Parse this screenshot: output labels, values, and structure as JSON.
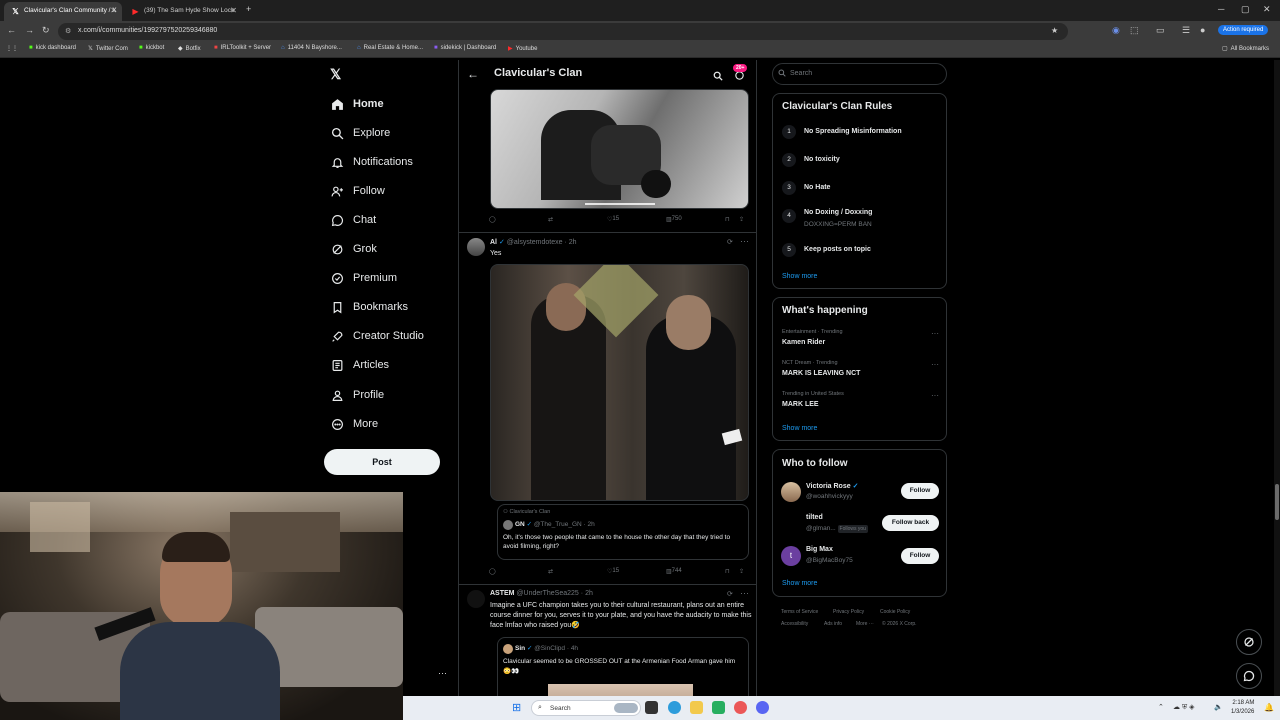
{
  "browser": {
    "tabs": [
      {
        "title": "Clavicular's Clan Community / X",
        "active": true
      },
      {
        "title": "(39) The Sam Hyde Show Lock",
        "active": false
      }
    ],
    "url": "x.com/i/communities/1992797520259346880",
    "action_required": "Action required",
    "bookmarks": [
      "kick dashboard",
      "Twitter Com",
      "kickbot",
      "Botfix",
      "IRLToolkit + Server",
      "11404 N Bayshore...",
      "Real Estate & Home...",
      "sidekick | Dashboard",
      "Youtube"
    ],
    "all_bookmarks": "All Bookmarks"
  },
  "nav": {
    "items": [
      {
        "label": "Home",
        "icon": "home-icon"
      },
      {
        "label": "Explore",
        "icon": "search-icon"
      },
      {
        "label": "Notifications",
        "icon": "bell-icon"
      },
      {
        "label": "Follow",
        "icon": "add-user-icon"
      },
      {
        "label": "Chat",
        "icon": "chat-icon"
      },
      {
        "label": "Grok",
        "icon": "grok-icon"
      },
      {
        "label": "Premium",
        "icon": "premium-icon"
      },
      {
        "label": "Bookmarks",
        "icon": "bookmark-icon"
      },
      {
        "label": "Creator Studio",
        "icon": "rocket-icon"
      },
      {
        "label": "Articles",
        "icon": "article-icon"
      },
      {
        "label": "Profile",
        "icon": "profile-icon"
      },
      {
        "label": "More",
        "icon": "more-icon"
      }
    ],
    "post_label": "Post"
  },
  "header": {
    "title": "Clavicular's Clan",
    "badge": "20+"
  },
  "feed": {
    "post1": {
      "replies": "",
      "reposts": "",
      "likes": "15",
      "views": "750"
    },
    "post2": {
      "name": "Al",
      "handle": "@alsystemdotexe",
      "time": "2h",
      "text": "Yes",
      "quote": {
        "community": "Clavicular's Clan",
        "name": "GN",
        "handle": "@The_True_GN",
        "time": "2h",
        "text": "Oh, it's those two people that came to the house the other day that they tried to avoid filming, right?"
      },
      "likes": "15",
      "views": "744"
    },
    "post3": {
      "name": "ASTEM",
      "handle": "@UnderTheSea225",
      "time": "2h",
      "text": "Imagine a UFC champion takes you to their cultural restaurant, plans out an entire course dinner for you, serves it to your plate, and you have the audacity to make this face lmfao who raised you🤣",
      "quote": {
        "name": "Sin",
        "handle": "@SinClipd",
        "time": "4h",
        "text": "Clavicular seemed to be GROSSED OUT at the Armenian Food Arman gave him 😳👀"
      }
    }
  },
  "sidebar": {
    "search_placeholder": "Search",
    "rules_title": "Clavicular's Clan Rules",
    "rules": [
      {
        "num": "1",
        "text": "No Spreading Misinformation",
        "sub": ""
      },
      {
        "num": "2",
        "text": "No toxicity",
        "sub": ""
      },
      {
        "num": "3",
        "text": "No Hate",
        "sub": ""
      },
      {
        "num": "4",
        "text": "No Doxing / Doxxing",
        "sub": "DOXXING=PERM BAN"
      },
      {
        "num": "5",
        "text": "Keep posts on topic",
        "sub": ""
      }
    ],
    "show_more": "Show more",
    "happening_title": "What's happening",
    "trends": [
      {
        "meta": "Entertainment · Trending",
        "name": "Kamen Rider"
      },
      {
        "meta": "NCT Dream · Trending",
        "name": "MARK IS LEAVING NCT"
      },
      {
        "meta": "Trending in United States",
        "name": "MARK LEE"
      }
    ],
    "wtf_title": "Who to follow",
    "who_to_follow": [
      {
        "name": "Victoria Rose",
        "handle": "@woahhvickyyy",
        "button": "Follow",
        "follows_you": ""
      },
      {
        "name": "tilted",
        "handle": "@glman...",
        "button": "Follow back",
        "follows_you": "Follows you"
      },
      {
        "name": "Big Max",
        "handle": "@BigMacBoy75",
        "button": "Follow",
        "follows_you": ""
      }
    ],
    "footer": [
      "Terms of Service",
      "Privacy Policy",
      "Cookie Policy",
      "Accessibility",
      "Ads info",
      "More ···",
      "© 2026 X Corp."
    ]
  },
  "taskbar": {
    "search": "Search",
    "time": "2:18 AM",
    "date": "1/3/2026"
  }
}
